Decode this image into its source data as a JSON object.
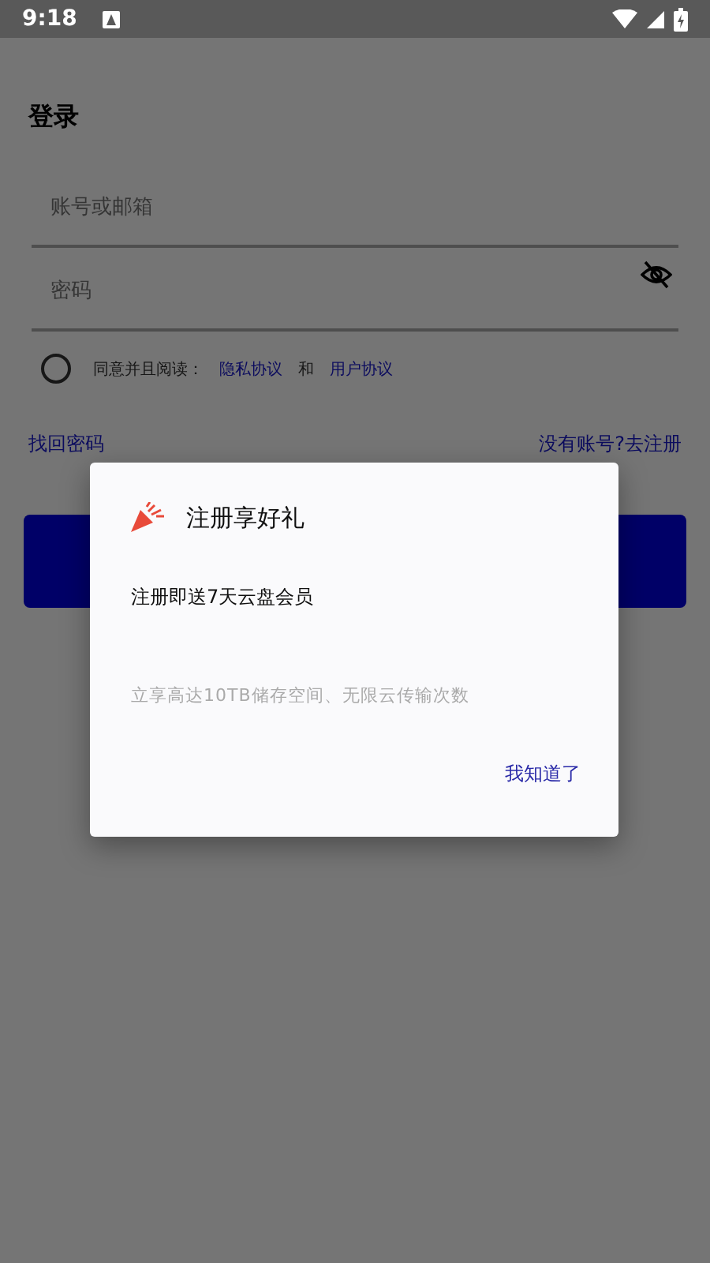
{
  "status_bar": {
    "time": "9:18"
  },
  "login": {
    "title": "登录",
    "account_field": {
      "placeholder": "账号或邮箱"
    },
    "password_field": {
      "placeholder": "密码",
      "password_visible": false
    },
    "agreement": {
      "checked": false,
      "text": "同意并且阅读：",
      "privacy_link": "隐私协议",
      "conjunction": "和",
      "user_link": "用户协议"
    },
    "forgot_link": "找回密码",
    "register_link": "没有账号?去注册"
  },
  "dialog": {
    "title": "注册享好礼",
    "message": "注册即送7天云盘会员",
    "detail": "立享高达10TB储存空间、无限云传输次数",
    "button": "我知道了"
  }
}
